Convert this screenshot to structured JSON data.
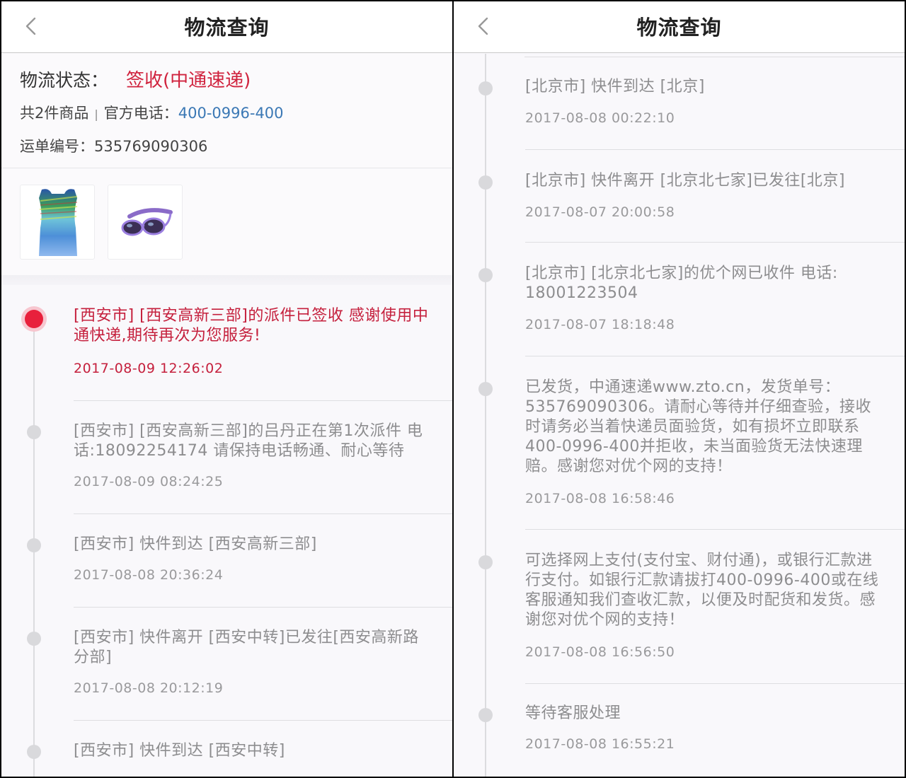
{
  "left": {
    "title": "物流查询",
    "status_label": "物流状态：",
    "status_value": "签收(中通速递)",
    "goods_count": "共2件商品",
    "phone_label": "官方电话：",
    "phone": "400-0996-400",
    "waybill_label": "运单编号：",
    "waybill": "535769090306",
    "goods": [
      {
        "icon": "swim-vest-image"
      },
      {
        "icon": "goggles-image"
      }
    ],
    "events": [
      {
        "desc": "[西安市] [西安高新三部]的派件已签收 感谢使用中通快递,期待再次为您服务!",
        "time": "2017-08-09 12:26:02",
        "active": true
      },
      {
        "desc": "[西安市] [西安高新三部]的吕丹正在第1次派件 电话:18092254174 请保持电话畅通、耐心等待",
        "time": "2017-08-09 08:24:25"
      },
      {
        "desc": "[西安市] 快件到达 [西安高新三部]",
        "time": "2017-08-08 20:36:24"
      },
      {
        "desc": "[西安市] 快件离开 [西安中转]已发往[西安高新路分部]",
        "time": "2017-08-08 20:12:19"
      },
      {
        "desc": "[西安市] 快件到达 [西安中转]",
        "time": ""
      }
    ]
  },
  "right": {
    "title": "物流查询",
    "events": [
      {
        "desc": "[北京市] 快件到达 [北京]",
        "time": "2017-08-08 00:22:10"
      },
      {
        "desc": "[北京市] 快件离开 [北京北七家]已发往[北京]",
        "time": "2017-08-07 20:00:58"
      },
      {
        "desc": "[北京市] [北京北七家]的优个网已收件 电话: 18001223504",
        "time": "2017-08-07 18:18:48"
      },
      {
        "desc": "已发货，中通速递www.zto.cn，发货单号：535769090306。请耐心等待并仔细查验，接收时请务必当着快递员面验货，如有损坏立即联系400-0996-400并拒收，未当面验货无法快速理赔。感谢您对优个网的支持！",
        "time": "2017-08-08 16:58:46"
      },
      {
        "desc": "可选择网上支付(支付宝、财付通)，或银行汇款进行支付。如银行汇款请拔打400-0996-400或在线客服通知我们查收汇款，以便及时配货和发货。感谢您对优个网的支持！",
        "time": "2017-08-08 16:56:50"
      },
      {
        "desc": "等待客服处理",
        "time": "2017-08-08 16:55:21"
      }
    ]
  },
  "colors": {
    "accent_red": "#d0233e",
    "link_blue": "#3b78b5",
    "muted_gray": "#8d8d8f"
  }
}
